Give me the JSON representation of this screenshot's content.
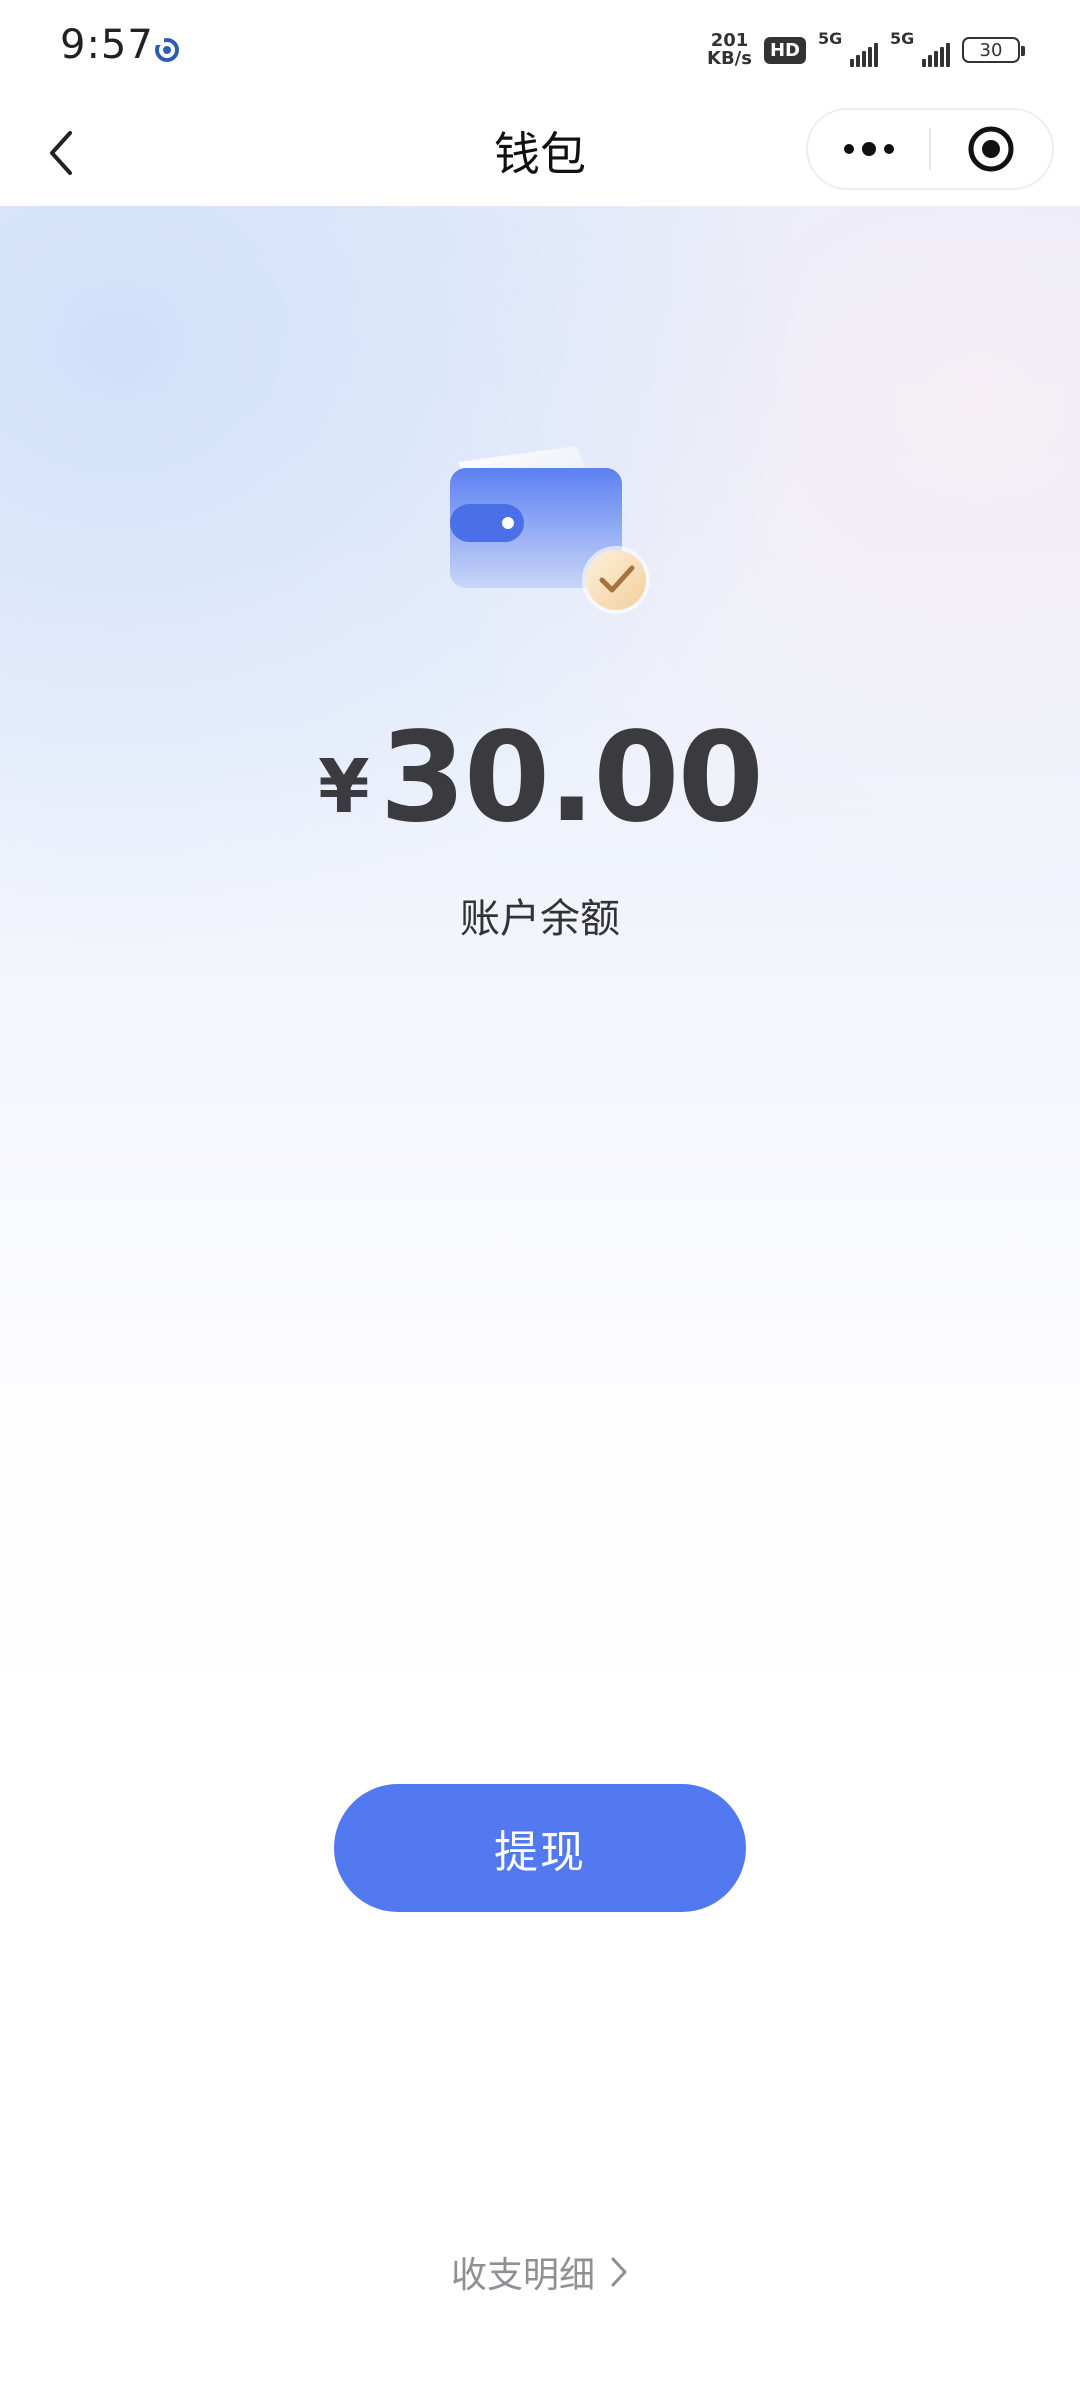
{
  "status_bar": {
    "time": "9:57",
    "net_speed_value": "201",
    "net_speed_unit": "KB/s",
    "hd_badge": "HD",
    "signal1_label": "5G",
    "signal2_label": "5G",
    "battery_level": "30"
  },
  "nav": {
    "title": "钱包",
    "back_icon": "chevron-left-icon",
    "more_icon": "more-dots-icon",
    "close_icon": "target-circle-icon"
  },
  "wallet": {
    "illustration_icon": "wallet-check-icon",
    "currency_symbol": "¥",
    "balance_amount": "30.00",
    "balance_label": "账户余额"
  },
  "actions": {
    "withdraw_label": "提现",
    "details_label": "收支明细",
    "details_icon": "chevron-right-icon"
  },
  "colors": {
    "primary": "#5279ef",
    "text_dark": "#3a3a3f",
    "text_muted": "#8f8f94"
  }
}
